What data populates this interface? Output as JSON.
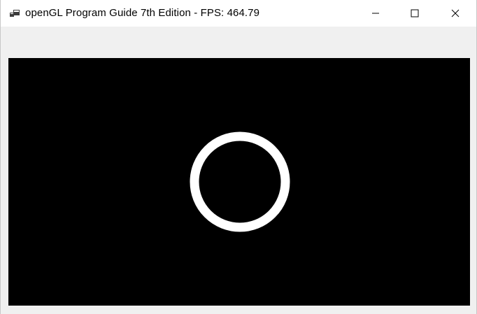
{
  "window": {
    "title": "openGL Program Guide 7th Edition - FPS: 464.79",
    "app_icon": "windows-forms-icon",
    "controls": {
      "minimize_icon": "minimize-icon",
      "maximize_icon": "maximize-icon",
      "close_icon": "close-icon"
    }
  },
  "canvas": {
    "background": "#000000",
    "shape": "ring",
    "shape_color": "#ffffff"
  },
  "colors": {
    "titlebar": "#ffffff",
    "client_area": "#f0f0f0"
  }
}
